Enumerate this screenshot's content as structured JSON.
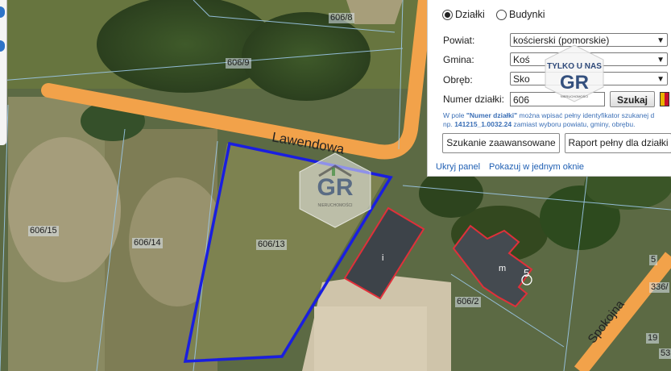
{
  "map": {
    "parcel_labels": [
      "606/8",
      "606/9",
      "606/15",
      "606/14",
      "606/13",
      "606/2",
      "336/",
      "19",
      "53",
      "5"
    ],
    "streets": [
      "Lawendowa",
      "Spokojna"
    ],
    "building_letters": [
      "i",
      "m"
    ],
    "address_number": "5",
    "colors": {
      "road": "#f2a24a",
      "parcel_highlight": "#1a1ee0",
      "building_outline": "#e0303a"
    }
  },
  "panel": {
    "radio_parcels": "Działki",
    "radio_buildings": "Budynki",
    "labels": {
      "county": "Powiat:",
      "commune": "Gmina:",
      "precinct": "Obręb:",
      "parcel_number": "Numer działki:"
    },
    "values": {
      "county": "kościerski (pomorskie)",
      "commune": "Koś",
      "precinct": "Sko",
      "parcel_number": "606"
    },
    "search_button": "Szukaj",
    "hint_line1_pre": "W pole ",
    "hint_line1_bold": "\"Numer działki\"",
    "hint_line1_post": " można wpisać pełny identyfikator szukanej d",
    "hint_line2_pre": "np. ",
    "hint_line2_bold": "141215_1.0032.24",
    "hint_line2_post": " zamiast wyboru powiatu, gminy, obrębu.",
    "advanced_search_button": "Szukanie zaawansowane",
    "full_report_button": "Raport pełny dla działki",
    "hide_panel_link": "Ukryj panel",
    "single_window_link": "Pokazuj w jednym oknie"
  },
  "watermark": {
    "tagline": "TYLKO U NAS",
    "logo": "GR",
    "subtitle": "NIERUCHOMOŚCI"
  }
}
